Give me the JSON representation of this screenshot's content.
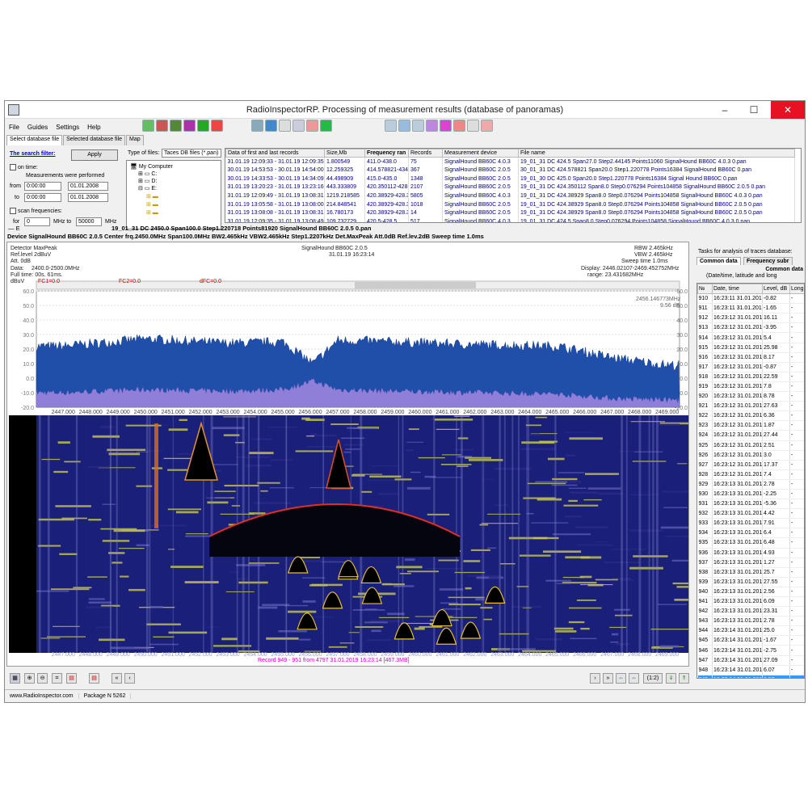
{
  "window": {
    "title": "RadioInspectorRP. Processing of measurement results (database of panoramas)",
    "min": "–",
    "max": "☐",
    "close": "✕"
  },
  "menu": [
    "File",
    "Guides",
    "Settings",
    "Help"
  ],
  "tabs": [
    "Select database file",
    "Selected database file",
    "Map"
  ],
  "filter": {
    "title": "The search filter:",
    "apply": "Apply",
    "on_time": "on time:",
    "measurements": "Measurements were performed",
    "from": "from",
    "to": "to",
    "time_from": "0:00:00",
    "time_to": "0:00:00",
    "date_from": "01.01.2008",
    "date_to": "01.01.2008",
    "scan": "scan frequencies:",
    "for": "for",
    "f_from": "0",
    "mhz_to": "MHz to",
    "f_to": "50000",
    "mhz": "MHz"
  },
  "tree": {
    "type_label": "Type of files:",
    "type_value": "Taces DB files (*.pan)",
    "items": [
      "My Computer",
      "C:",
      "D:",
      "E:"
    ]
  },
  "db_table": {
    "headers": [
      "Data of first and last records",
      "Size,Mb",
      "Frequency ran",
      "Records",
      "Measurement device",
      "File name"
    ],
    "rows": [
      [
        "31.01.19 12:09:33 - 31.01.19 12:09:35",
        "1.800549",
        "411.0-438.0",
        "75",
        "SignalHound BB60C 4.0.3",
        "19_01_31 DC 424.5 Span27.0 Step2.44145 Points11060 SignalHound BB60C 4.0.3 0.pan"
      ],
      [
        "30.01.19 14:53:53 - 30.01.19 14:54:00",
        "12.259325",
        "414.578821-434.",
        "367",
        "SignalHound BB60C 2.0.5",
        "30_01_31 DC 424.578821 Span20.0 Step1.220778 Points16384 SignalHound BB60C 0.pan"
      ],
      [
        "30.01.19 14:33:53 - 30.01.19 14:34:09",
        "44.498909",
        "415.0-435.0",
        "1348",
        "SignalHound BB60C 2.0.5",
        "19_01_30 DC 425.0 Span20.0 Step1.220778 Points16384 Signal Hound BB60C 0.pan"
      ],
      [
        "31.01.19 13:20:23 - 31.01.19 13:23:16",
        "443.333809",
        "420.350112-428.",
        "2107",
        "SignalHound BB60C 2.0.5",
        "19_01_31 DC 424.350112 Span8.0 Step0.076294 Points104858 SignalHound BB60C 2.0.5 0.pan"
      ],
      [
        "31.01.19 12:09:49 - 31.01.19 13:08:31",
        "1219.218585",
        "420.38929-428.3",
        "5805",
        "SignalHound BB60C 4.0.3",
        "19_01_31 DC 424.38929 Span8.0 Step0.076294 Points104858 SignalHound BB60C 4.0.3 0.pan"
      ],
      [
        "31.01.19 13:05:58 - 31.01.19 13:08:00",
        "214.848541",
        "420.38929-428.3",
        "1018",
        "SignalHound BB60C 2.0.5",
        "19_01_31 DC 424.38929 Span8.0 Step0.076294 Points104858 SignalHound BB60C 2.0.5 0.pan"
      ],
      [
        "31.01.19 13:08:08 - 31.01.19 13:08:31",
        "16.780173",
        "420.38929-428.3",
        "14",
        "SignalHound BB60C 2.0.5",
        "19_01_31 DC 424.38929 Span8.0 Step0.076294 Points104858 SignalHound BB60C 2.0.5 0.pan"
      ],
      [
        "31.01.19 12:09:35 - 31.01.19 13:08:49",
        "109.732729",
        "420.5-428.5",
        "517",
        "SignalHound BB60C 4.0.3",
        "19_01_31 DC 424.5 Span8.0 Step0.076294 Points104858 SignalHound BB60C 4.0.3 0.pan"
      ]
    ]
  },
  "file_line": "19_01_31 DC 2450.0 Span100.0 Step1.220718 Points81920 SignalHound BB60C 2.0.5 0.pan",
  "device_line": "Device  SignalHound BB60C 2.0.5   Center frq.2450.0MHz  Span100.0MHz  BW2.465kHz  VBW2.465kHz  Step1.2207kHz  Det.MaxPeak  Att.0dB  Ref.lev.2dB  Sweep time 1.0ms",
  "spectrum": {
    "detector": "Detector MaxPeak",
    "reflevel": "Ref.level 2dBuV",
    "att": "Att.  0dB",
    "data": "Data:",
    "data_val": "2400.0-2500.0MHz",
    "fulltime": "Full time:  00s. 61ms.",
    "device": "SignalHound BB60C 2.0.5",
    "datetime": "31.01.19 16:23:14",
    "rbw": "RBW  2.465kHz",
    "vbw": "VBW  2.465kHz",
    "sweep": "Sweep time  1.0ms",
    "display": "Display:  2446.02107-2469.452752MHz",
    "range": "range:   23.431682MHz",
    "fc1": "FC1=0.0",
    "fc2": "FC2=0.0",
    "dfc": "dFC=0.0",
    "unit": "dBuV",
    "marker": "2456.146773MHz",
    "marker2": "9.56 dB",
    "record": "Record 949 - 951  from 4797  31.01.2019 16:23:14 [467.3MB]",
    "x_ticks": [
      "2447.000",
      "2448.000",
      "2449.000",
      "2450.000",
      "2451.000",
      "2452.000",
      "2453.000",
      "2454.000",
      "2455.000",
      "2456.000",
      "2457.000",
      "2458.000",
      "2459.000",
      "2460.000",
      "2461.000",
      "2462.000",
      "2463.000",
      "2464.000",
      "2465.000",
      "2466.000",
      "2467.000",
      "2468.000",
      "2469.000"
    ],
    "y_ticks": [
      "60.0",
      "50.0",
      "40.0",
      "30.0",
      "20.0",
      "10.0",
      "0.0",
      "-10.0",
      "-20.0"
    ],
    "y_ticks_right": [
      "60.0",
      "50.0",
      "40.0",
      "30.0",
      "20.0",
      "10.0",
      "0.0",
      "-10.0",
      "-20.0"
    ]
  },
  "chart_data": {
    "type": "area",
    "xlabel": "",
    "ylabel": "dBuV",
    "xlim": [
      2446.02107,
      2469.452752
    ],
    "ylim": [
      -20,
      60
    ],
    "series": [
      {
        "name": "MaxPeak",
        "x": [
          2447,
          2450,
          2453,
          2455,
          2456.1,
          2457,
          2459,
          2462,
          2465,
          2467,
          2469
        ],
        "values": [
          22,
          27,
          24,
          25,
          10,
          26,
          25,
          23,
          22,
          14,
          9
        ]
      },
      {
        "values": [
          -10,
          -8,
          -9,
          -8,
          -2,
          -8,
          -9,
          -10,
          -11,
          -14,
          -15
        ]
      }
    ]
  },
  "bottom": {
    "zoom": "(1:2)"
  },
  "status": {
    "site": "www.RadioInspector.com",
    "package": "Package N 5262"
  },
  "right": {
    "title": "Tasks for analysis of traces database:",
    "tab1": "Common data",
    "tab2": "Frequency subr",
    "common": "Common data",
    "sub": "(Date/time, latitude and long",
    "headers": [
      "№",
      "Date, time",
      "Level, dB",
      "Longit"
    ],
    "rows": [
      [
        "910",
        "16:23:11 31.01.201",
        "-0.82",
        "-"
      ],
      [
        "911",
        "16:23:11 31.01.201",
        "-1.65",
        "-"
      ],
      [
        "912",
        "16:23:12 31.01.201",
        "16.11",
        "-"
      ],
      [
        "913",
        "16:23:12 31.01.201",
        "-3.95",
        "-"
      ],
      [
        "914",
        "16:23:12 31.01.201",
        "5.4",
        "-"
      ],
      [
        "915",
        "16:23:12 31.01.201",
        "25.98",
        "-"
      ],
      [
        "916",
        "16:23:12 31.01.201",
        "8.17",
        "-"
      ],
      [
        "917",
        "16:23:12 31.01.201",
        "-0.87",
        "-"
      ],
      [
        "918",
        "16:23:12 31.01.201",
        "22.59",
        "-"
      ],
      [
        "919",
        "16:23:12 31.01.201",
        "7.8",
        "-"
      ],
      [
        "920",
        "16:23:12 31.01.201",
        "8.78",
        "-"
      ],
      [
        "921",
        "16:23:12 31.01.201",
        "27.63",
        "-"
      ],
      [
        "922",
        "16:23:12 31.01.201",
        "6.36",
        "-"
      ],
      [
        "923",
        "16:23:12 31.01.201",
        "1.87",
        "-"
      ],
      [
        "924",
        "16:23:12 31.01.201",
        "27.44",
        "-"
      ],
      [
        "925",
        "16:23:12 31.01.201",
        "2.51",
        "-"
      ],
      [
        "926",
        "16:23:12 31.01.201",
        "3.0",
        "-"
      ],
      [
        "927",
        "16:23:12 31.01.201",
        "17.37",
        "-"
      ],
      [
        "928",
        "16:23:12 31.01.201",
        "7.4",
        "-"
      ],
      [
        "929",
        "16:23:13 31.01.201",
        "2.78",
        "-"
      ],
      [
        "930",
        "16:23:13 31.01.201",
        "-2.25",
        "-"
      ],
      [
        "931",
        "16:23:13 31.01.201",
        "-5.36",
        "-"
      ],
      [
        "932",
        "16:23:13 31.01.201",
        "4.42",
        "-"
      ],
      [
        "933",
        "16:23:13 31.01.201",
        "7.91",
        "-"
      ],
      [
        "934",
        "16:23:13 31.01.201",
        "6.4",
        "-"
      ],
      [
        "935",
        "16:23:13 31.01.201",
        "6.48",
        "-"
      ],
      [
        "936",
        "16:23:13 31.01.201",
        "4.93",
        "-"
      ],
      [
        "937",
        "16:23:13 31.01.201",
        "1.27",
        "-"
      ],
      [
        "938",
        "16:23:13 31.01.201",
        "25.7",
        "-"
      ],
      [
        "939",
        "16:23:13 31.01.201",
        "27.55",
        "-"
      ],
      [
        "940",
        "16:23:13 31.01.201",
        "2.56",
        "-"
      ],
      [
        "941",
        "16:23:13 31.01.201",
        "6.09",
        "-"
      ],
      [
        "942",
        "16:23:13 31.01.201",
        "23.31",
        "-"
      ],
      [
        "943",
        "16:23:13 31.01.201",
        "2.78",
        "-"
      ],
      [
        "944",
        "16:23:14 31.01.201",
        "25.0",
        "-"
      ],
      [
        "945",
        "16:23:14 31.01.201",
        "-1.67",
        "-"
      ],
      [
        "946",
        "16:23:14 31.01.201",
        "-2.75",
        "-"
      ],
      [
        "947",
        "16:23:14 31.01.201",
        "27.09",
        "-"
      ],
      [
        "948",
        "16:23:14 31.01.201",
        "6.07",
        "-"
      ],
      [
        "949",
        "16:23:14 31.01.201",
        "2.53",
        "-"
      ]
    ]
  }
}
